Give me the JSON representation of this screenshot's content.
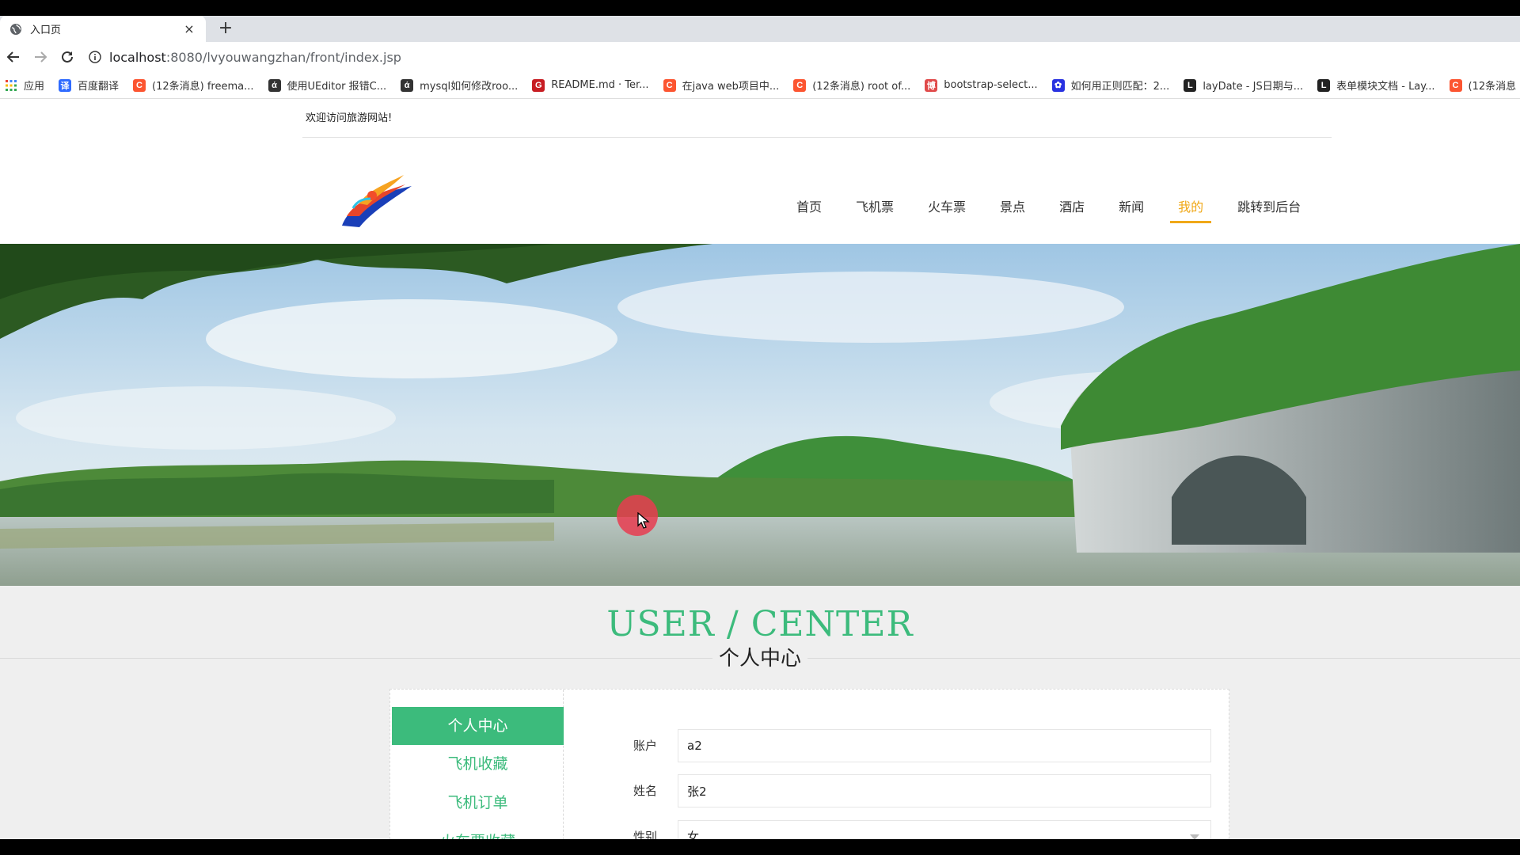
{
  "browser": {
    "tab_title": "入口页",
    "new_tab_symbol": "+",
    "close_symbol": "×",
    "url_host": "localhost",
    "url_path": ":8080/lvyouwangzhan/front/index.jsp",
    "bookmarks": [
      {
        "label": "应用",
        "icon": "apps-grid-icon",
        "color": "#4285f4",
        "glyph": ""
      },
      {
        "label": "百度翻译",
        "icon": "baidu-translate-icon",
        "color": "#2f6bff",
        "glyph": "译"
      },
      {
        "label": "(12条消息) freema...",
        "icon": "csdn-icon",
        "color": "#fc5531",
        "glyph": "C"
      },
      {
        "label": "使用UEditor 报错C...",
        "icon": "segmentfault-icon",
        "color": "#333333",
        "glyph": "ά"
      },
      {
        "label": "mysql如何修改roo...",
        "icon": "segmentfault-icon",
        "color": "#333333",
        "glyph": "ά"
      },
      {
        "label": "README.md · Ter...",
        "icon": "gitee-icon",
        "color": "#c71d23",
        "glyph": "G"
      },
      {
        "label": "在java web项目中...",
        "icon": "csdn-icon",
        "color": "#fc5531",
        "glyph": "C"
      },
      {
        "label": "(12条消息) root of...",
        "icon": "csdn-icon",
        "color": "#fc5531",
        "glyph": "C"
      },
      {
        "label": "bootstrap-select...",
        "icon": "cnblogs-icon",
        "color": "#e04a4a",
        "glyph": "博"
      },
      {
        "label": "如何用正则匹配：2...",
        "icon": "baidu-paw-icon",
        "color": "#2932e1",
        "glyph": "✿"
      },
      {
        "label": "layDate - JS日期与...",
        "icon": "layui-icon",
        "color": "#222222",
        "glyph": "L"
      },
      {
        "label": "表单模块文档 - Lay...",
        "icon": "layui-icon",
        "color": "#222222",
        "glyph": "L"
      },
      {
        "label": "(12条消息",
        "icon": "csdn-icon",
        "color": "#fc5531",
        "glyph": "C"
      }
    ]
  },
  "site": {
    "welcome": "欢迎访问旅游网站!",
    "nav": [
      {
        "label": "首页",
        "active": false
      },
      {
        "label": "飞机票",
        "active": false
      },
      {
        "label": "火车票",
        "active": false
      },
      {
        "label": "景点",
        "active": false
      },
      {
        "label": "酒店",
        "active": false
      },
      {
        "label": "新闻",
        "active": false
      },
      {
        "label": "我的",
        "active": true
      },
      {
        "label": "跳转到后台",
        "active": false
      }
    ],
    "accent_color": "#3cbb7c",
    "nav_active_color": "#f0a818"
  },
  "section": {
    "title_en": "USER / CENTER",
    "title_cn": "个人中心"
  },
  "sidemenu": [
    {
      "label": "个人中心",
      "active": true
    },
    {
      "label": "飞机收藏",
      "active": false
    },
    {
      "label": "飞机订单",
      "active": false
    },
    {
      "label": "火车票收藏",
      "active": false
    }
  ],
  "form": {
    "account_label": "账户",
    "account_value": "a2",
    "name_label": "姓名",
    "name_value": "张2",
    "gender_label": "性别",
    "gender_value": "女"
  }
}
